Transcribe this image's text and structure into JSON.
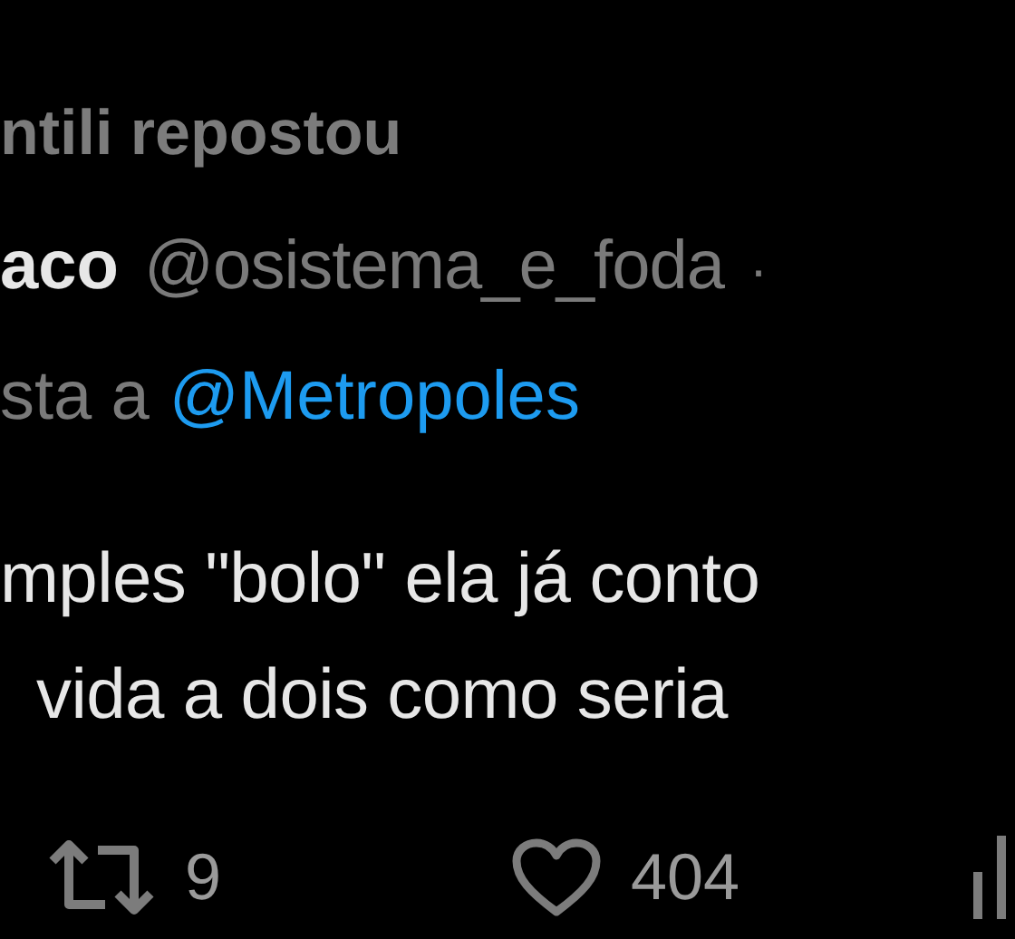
{
  "repost_line": "ntili repostou",
  "author": {
    "name": "aco",
    "handle": "@osistema_e_foda",
    "separator": "·"
  },
  "reply_to": {
    "prefix": "sta a",
    "mention": "@Metropoles"
  },
  "body": [
    "mples \"bolo\" ela já conto",
    "vida a dois como seria"
  ],
  "actions": [
    {
      "kind": "repost",
      "count": "9"
    },
    {
      "kind": "like",
      "count": "404"
    },
    {
      "kind": "views"
    }
  ]
}
